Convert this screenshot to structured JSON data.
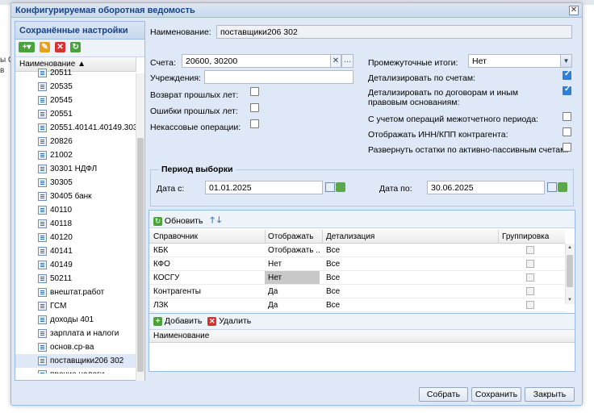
{
  "background": {
    "left_text": "ы О\nв"
  },
  "dialog": {
    "title": "Конфигурируемая оборотная ведомость",
    "close_icon": "close-icon"
  },
  "left_panel": {
    "header": "Сохранённые настройки",
    "column_header": "Наименование ▲",
    "items": [
      "20511",
      "20535",
      "20545",
      "20551",
      "20551.40141.40149.303...",
      "20826",
      "21002",
      "30301 НДФЛ",
      "30305",
      "30405 банк",
      "40110",
      "40118",
      "40120",
      "40141",
      "40149",
      "50211",
      "внештат.работ",
      "ГСМ",
      "доходы 401",
      "зарплата и налоги",
      "основ.ср-ва",
      "поставщики206 302",
      "прочие налоги"
    ],
    "selected": "поставщики206 302"
  },
  "form": {
    "name_label": "Наименование:",
    "name_value": "поставщики206 302",
    "accounts_label": "Счета:",
    "accounts_value": "20600, 30200",
    "institutions_label": "Учреждения:",
    "institutions_value": "",
    "prev_years_return_label": "Возврат прошлых лет:",
    "prev_years_errors_label": "Ошибки прошлых лет:",
    "noncash_label": "Некассовые операции:",
    "subtotals_label": "Промежуточные итоги:",
    "subtotals_value": "Нет",
    "detail_accounts_label": "Детализировать по счетам:",
    "detail_contracts_label": "Детализировать по договорам и иным правовым основаниям:",
    "interperiod_label": "С учетом операций межотчетного периода:",
    "inn_kpp_label": "Отображать ИНН/КПП контрагента:",
    "active_passive_label": "Развернуть остатки по активно-пассивным счетам:",
    "checks": {
      "prev_years_return": false,
      "prev_years_errors": false,
      "noncash": false,
      "detail_accounts": true,
      "detail_contracts": true,
      "interperiod": false,
      "inn_kpp": false,
      "active_passive": false
    }
  },
  "period": {
    "legend": "Период выборки",
    "from_label": "Дата с:",
    "from_value": "01.01.2025",
    "to_label": "Дата по:",
    "to_value": "30.06.2025"
  },
  "grid": {
    "refresh_label": "Обновить",
    "columns": [
      "Справочник",
      "Отображать",
      "Детализация",
      "Группировка"
    ],
    "rows": [
      {
        "ref": "КБК",
        "show": "Отображать ...",
        "detail": "Все"
      },
      {
        "ref": "КФО",
        "show": "Нет",
        "detail": "Все"
      },
      {
        "ref": "КОСГУ",
        "show": "Нет",
        "detail": "Все"
      },
      {
        "ref": "Контрагенты",
        "show": "Да",
        "detail": "Все"
      },
      {
        "ref": "ЛЗК",
        "show": "Да",
        "detail": "Все"
      }
    ]
  },
  "subgrid": {
    "add_label": "Добавить",
    "delete_label": "Удалить",
    "column": "Наименование"
  },
  "buttons": {
    "collect": "Собрать",
    "save": "Сохранить",
    "close": "Закрыть"
  },
  "colors": {
    "accent": "#15428b",
    "panel_bg": "#dfe8f6",
    "border": "#99bbe8",
    "check": "#2f7fd6"
  }
}
